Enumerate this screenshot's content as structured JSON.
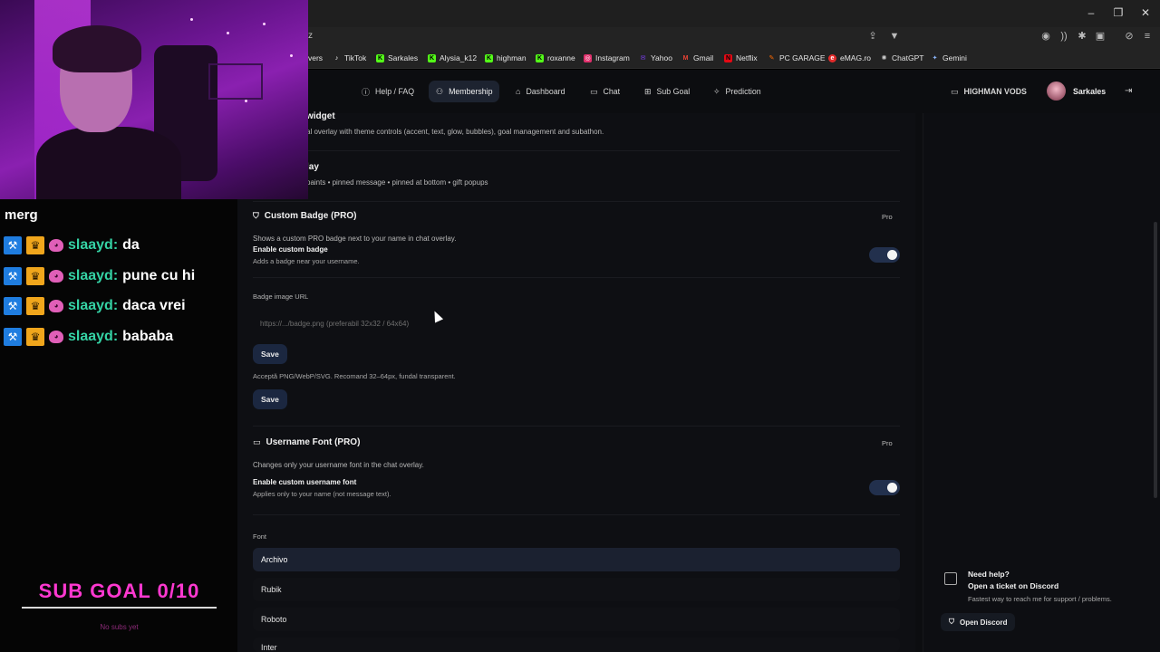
{
  "browser": {
    "url": "z",
    "bookmarks": [
      {
        "label": "vers",
        "icon": "folder-icon",
        "color": "#9aa0a6"
      },
      {
        "label": "TikTok",
        "icon": "tiktok-icon",
        "color": "#ffffff"
      },
      {
        "label": "Sarkales",
        "icon": "kick-icon",
        "color": "#53fc18"
      },
      {
        "label": "Alysia_k12",
        "icon": "kick-icon",
        "color": "#53fc18"
      },
      {
        "label": "highman",
        "icon": "kick-icon",
        "color": "#53fc18"
      },
      {
        "label": "roxanne",
        "icon": "kick-icon",
        "color": "#53fc18"
      },
      {
        "label": "Instagram",
        "icon": "instagram-icon",
        "color": "#e1306c"
      },
      {
        "label": "Yahoo",
        "icon": "yahoo-icon",
        "color": "#6001d2"
      },
      {
        "label": "Gmail",
        "icon": "gmail-icon",
        "color": "#ea4335"
      },
      {
        "label": "Netflix",
        "icon": "netflix-icon",
        "color": "#e50914"
      },
      {
        "label": "PC GARAGE",
        "icon": "pcgarage-icon",
        "color": "#ff6a00"
      },
      {
        "label": "eMAG.ro",
        "icon": "emag-icon",
        "color": "#e32b2b"
      },
      {
        "label": "ChatGPT",
        "icon": "chatgpt-icon",
        "color": "#cfcfcf"
      },
      {
        "label": "Gemini",
        "icon": "gemini-icon",
        "color": "#8ab4f8"
      }
    ]
  },
  "nav": {
    "items": [
      {
        "label": "Help / FAQ",
        "icon": "help-circle-icon"
      },
      {
        "label": "Membership",
        "icon": "user-icon",
        "active": true
      },
      {
        "label": "Dashboard",
        "icon": "home-icon"
      },
      {
        "label": "Chat",
        "icon": "chat-icon"
      },
      {
        "label": "Sub Goal",
        "icon": "gift-icon"
      },
      {
        "label": "Prediction",
        "icon": "sparkle-icon"
      }
    ],
    "vods_label": "HIGHMAN VODS",
    "username": "Sarkales"
  },
  "sections": {
    "widget_title": "widget",
    "widget_desc": "al overlay with theme controls (accent, text, glow, bubbles), goal management and subathon.",
    "overlay_title": "lay",
    "overlay_desc": "paints • pinned message • pinned at bottom • gift popups",
    "badge": {
      "title": "Custom Badge (PRO)",
      "pro": "Pro",
      "desc": "Shows a custom PRO badge next to your name in chat overlay.",
      "enable_label": "Enable custom badge",
      "enable_sub": "Adds a badge near your username.",
      "url_label": "Badge image URL",
      "url_placeholder": "https://.../badge.png (preferabil 32x32 / 64x64)",
      "save1": "Save",
      "hint": "Acceptă PNG/WebP/SVG. Recomand 32–64px, fundal transparent.",
      "save2": "Save"
    },
    "font": {
      "title": "Username Font (PRO)",
      "pro": "Pro",
      "desc": "Changes only your username font in the chat overlay.",
      "enable_label": "Enable custom username font",
      "enable_sub": "Applies only to your name (not message text).",
      "font_label": "Font",
      "options": [
        "Archivo",
        "Rubik",
        "Roboto",
        "Inter"
      ],
      "selected": "Archivo"
    }
  },
  "help": {
    "title": "Need help?",
    "line": "Open a ticket on Discord",
    "sub": "Fastest way to reach me for support / problems.",
    "button": "Open Discord"
  },
  "stream": {
    "partial_message": "merg",
    "chat": [
      {
        "user": "slaayd:",
        "msg": "da"
      },
      {
        "user": "slaayd:",
        "msg": "pune cu hi"
      },
      {
        "user": "slaayd:",
        "msg": "daca vrei"
      },
      {
        "user": "slaayd:",
        "msg": "bababa"
      }
    ],
    "subgoal": "SUB GOAL 0/10",
    "subgoal_sub": "No subs yet"
  },
  "colors": {
    "accent": "#1b2740",
    "chat_user": "#35d3a5",
    "subgoal": "#ff38d0"
  }
}
